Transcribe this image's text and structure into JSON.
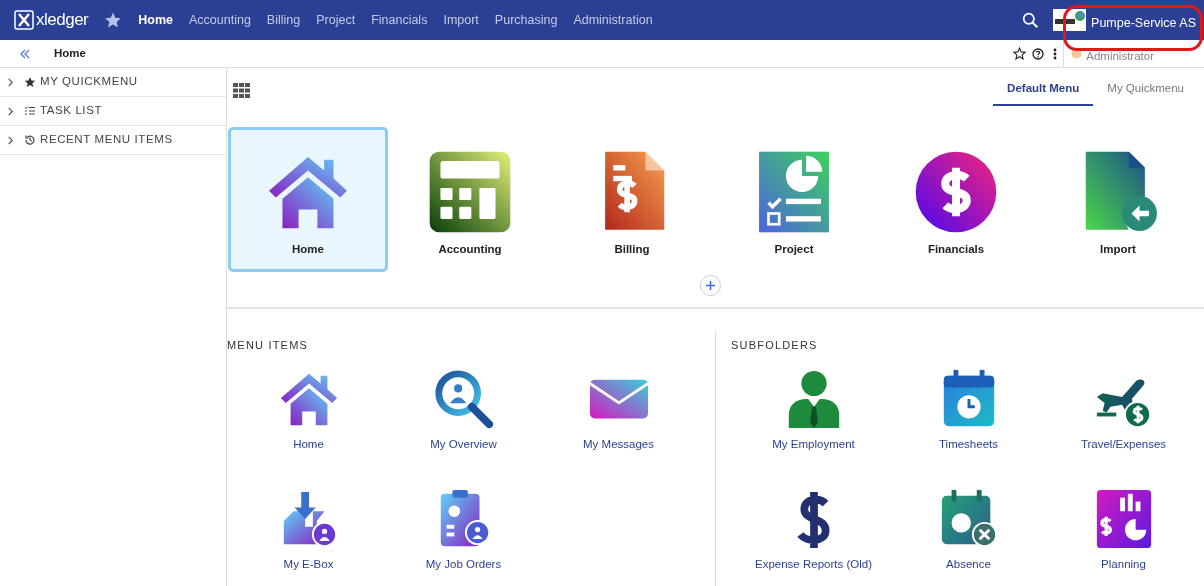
{
  "navbar": {
    "brand": "xledger",
    "items": [
      {
        "label": "Home",
        "selected": true
      },
      {
        "label": "Accounting",
        "selected": false
      },
      {
        "label": "Billing",
        "selected": false
      },
      {
        "label": "Project",
        "selected": false
      },
      {
        "label": "Financials",
        "selected": false
      },
      {
        "label": "Import",
        "selected": false
      },
      {
        "label": "Purchasing",
        "selected": false
      },
      {
        "label": "Administration",
        "selected": false
      }
    ],
    "user": {
      "company": "Pumpe-Service AS",
      "role": "Administrator"
    }
  },
  "breadcrumb": "Home",
  "sidebar": {
    "items": [
      {
        "label": "MY QUICKMENU",
        "expanded": false
      },
      {
        "label": "TASK LIST",
        "expanded": false
      },
      {
        "label": "RECENT MENU ITEMS",
        "expanded": false
      }
    ]
  },
  "tabs": [
    {
      "label": "Default Menu",
      "selected": true
    },
    {
      "label": "My Quickmenu",
      "selected": false
    }
  ],
  "tiles": [
    {
      "label": "Home",
      "selected": true
    },
    {
      "label": "Accounting",
      "selected": false
    },
    {
      "label": "Billing",
      "selected": false
    },
    {
      "label": "Project",
      "selected": false
    },
    {
      "label": "Financials",
      "selected": false
    },
    {
      "label": "Import",
      "selected": false
    }
  ],
  "menu_items": {
    "title": "MENU ITEMS",
    "items": [
      "Home",
      "My Overview",
      "My Messages",
      "My E-Box",
      "My Job Orders"
    ]
  },
  "subfolders": {
    "title": "SUBFOLDERS",
    "items": [
      "My Employment",
      "Timesheets",
      "Travel/Expenses",
      "Expense Reports (Old)",
      "Absence",
      "Planning"
    ]
  }
}
